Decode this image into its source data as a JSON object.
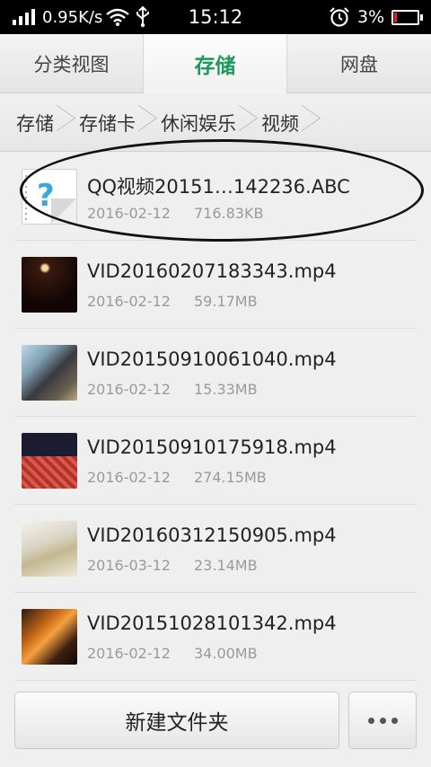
{
  "status_bar": {
    "net_speed": "0.95K/s",
    "time": "15:12",
    "battery_percent": "3%",
    "battery_level": 0.03,
    "icons": [
      "signal-icon",
      "wifi-icon",
      "usb-icon",
      "alarm-icon",
      "battery-icon"
    ]
  },
  "tabs": [
    {
      "label": "分类视图",
      "active": false
    },
    {
      "label": "存储",
      "active": true
    },
    {
      "label": "网盘",
      "active": false
    }
  ],
  "breadcrumb": [
    "存储",
    "存储卡",
    "休闲娱乐",
    "视频"
  ],
  "files": [
    {
      "name": "QQ视频20151…142236.ABC",
      "date": "2016-02-12",
      "size": "716.83KB",
      "icon": "unknown-file-icon"
    },
    {
      "name": "VID20160207183343.mp4",
      "date": "2016-02-12",
      "size": "59.17MB",
      "icon": "video-thumbnail"
    },
    {
      "name": "VID20150910061040.mp4",
      "date": "2016-02-12",
      "size": "15.33MB",
      "icon": "video-thumbnail"
    },
    {
      "name": "VID20150910175918.mp4",
      "date": "2016-02-12",
      "size": "274.15MB",
      "icon": "video-thumbnail"
    },
    {
      "name": "VID20160312150905.mp4",
      "date": "2016-03-12",
      "size": "23.14MB",
      "icon": "video-thumbnail"
    },
    {
      "name": "VID20151028101342.mp4",
      "date": "2016-02-12",
      "size": "34.00MB",
      "icon": "video-thumbnail"
    }
  ],
  "bottom": {
    "new_folder_label": "新建文件夹",
    "more_icon": "more-dots-icon"
  },
  "colors": {
    "accent": "#1c9a5e",
    "status_bar": "#000000",
    "battery_low": "#e02020"
  }
}
